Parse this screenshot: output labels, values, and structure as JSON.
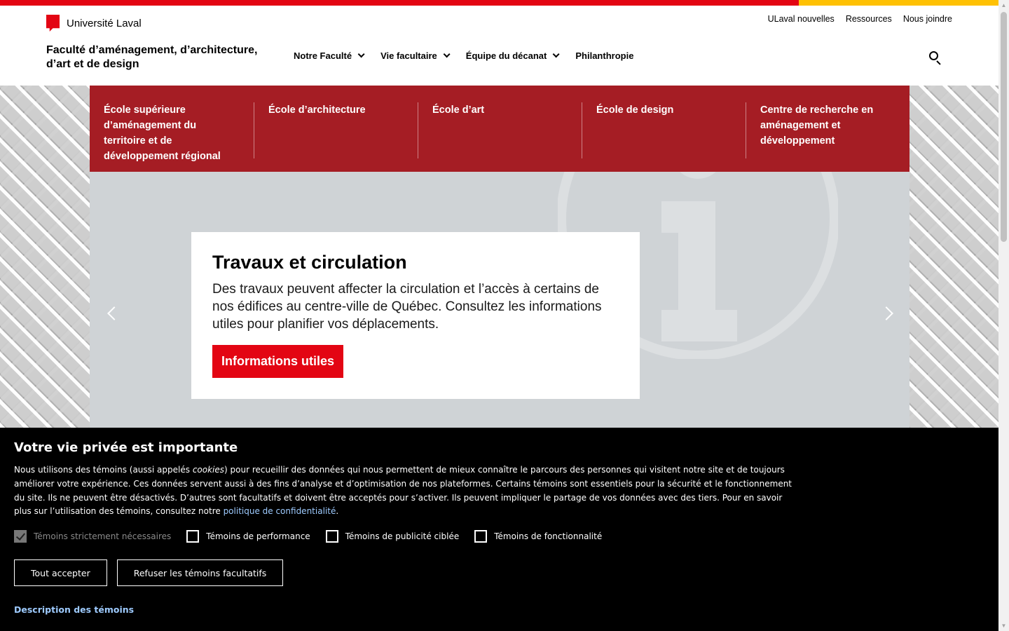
{
  "brand": {
    "university": "Université Laval"
  },
  "utility_nav": [
    "ULaval nouvelles",
    "Ressources",
    "Nous joindre"
  ],
  "faculty_title_line1": "Faculté d’aménagement, d’architecture,",
  "faculty_title_line2": "d’art et de design",
  "main_nav": [
    {
      "label": "Notre Faculté",
      "has_dropdown": true
    },
    {
      "label": "Vie facultaire",
      "has_dropdown": true
    },
    {
      "label": "Équipe du décanat",
      "has_dropdown": true
    },
    {
      "label": "Philanthropie",
      "has_dropdown": false
    }
  ],
  "schools": [
    "École supérieure d’aménagement du territoire et de développement régional",
    "École d’architecture",
    "École d’art",
    "École de design",
    "Centre de recherche en aménagement et développement"
  ],
  "slide": {
    "title": "Travaux et circulation",
    "body": "Des travaux peuvent affecter la circulation et l’accès à certains de nos édifices au centre-ville de Québec. Consultez les informations utiles pour planifier vos déplacements.",
    "cta": "Informations utiles"
  },
  "cookie": {
    "title": "Votre vie privée est importante",
    "text_part1": "Nous utilisons des témoins (aussi appelés ",
    "text_em": "cookies",
    "text_part2": ") pour recueillir des données qui nous permettent de mieux connaître le parcours des personnes qui visitent notre site et de toujours améliorer votre expérience. Ces données servent aussi à des fins d’analyse et d’optimisation de nos plateformes. Certains témoins sont essentiels pour la sécurité et le fonctionnement du site. Ils ne peuvent être désactivés. D’autres sont facultatifs et doivent être acceptés pour s’activer. Ils peuvent impliquer le partage de vos données avec des tiers. Pour en savoir plus sur l’utilisation des témoins, consultez notre ",
    "link": "politique de confidentialité",
    "text_end": ".",
    "options": [
      {
        "label": "Témoins strictement nécessaires",
        "checked": true,
        "disabled": true
      },
      {
        "label": "Témoins de performance",
        "checked": false,
        "disabled": false
      },
      {
        "label": "Témoins de publicité ciblée",
        "checked": false,
        "disabled": false
      },
      {
        "label": "Témoins de fonctionnalité",
        "checked": false,
        "disabled": false
      }
    ],
    "accept_all": "Tout accepter",
    "refuse": "Refuser les témoins facultatifs",
    "description_link": "Description des témoins"
  },
  "colors": {
    "accent_red": "#e30513",
    "school_bar": "#a51d24",
    "yellow": "#ffc103"
  }
}
